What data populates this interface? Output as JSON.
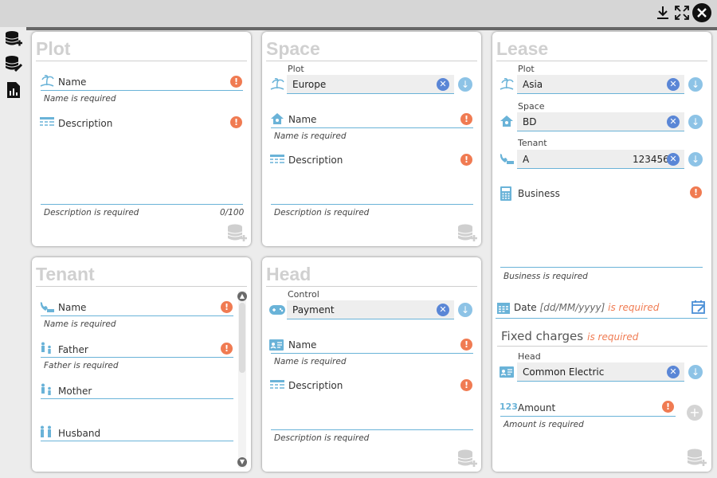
{
  "window": {
    "download_icon": "download-icon",
    "expand_icon": "expand-icon",
    "close_icon": "close-icon"
  },
  "sidebar": {
    "items": [
      {
        "icon": "database-add-icon"
      },
      {
        "icon": "database-edit-icon"
      },
      {
        "icon": "report-document-icon"
      }
    ]
  },
  "plot": {
    "title": "Plot",
    "name_label": "Name",
    "name_hint": "Name is required",
    "description_label": "Description",
    "description_hint": "Description is required",
    "description_counter": "0/100"
  },
  "space": {
    "title": "Space",
    "plot_label": "Plot",
    "plot_value": "Europe",
    "name_label": "Name",
    "name_hint": "Name is required",
    "description_label": "Description",
    "description_hint": "Description is required"
  },
  "lease": {
    "title": "Lease",
    "plot_label": "Plot",
    "plot_value": "Asia",
    "space_label": "Space",
    "space_value": "BD",
    "tenant_label": "Tenant",
    "tenant_value": "A",
    "tenant_phone": "123456",
    "business_label": "Business",
    "business_hint": "Business is required",
    "date_label": "Date",
    "date_placeholder": "[dd/MM/yyyy]",
    "date_required": "is required",
    "fixed_charges_label": "Fixed charges",
    "fixed_charges_required": "is required",
    "head_label": "Head",
    "head_value": "Common Electric",
    "amount_label": "Amount",
    "amount_icon_text": "123",
    "amount_hint": "Amount is required"
  },
  "tenant": {
    "title": "Tenant",
    "name_label": "Name",
    "name_hint": "Name is required",
    "father_label": "Father",
    "father_hint": "Father is required",
    "mother_label": "Mother",
    "husband_label": "Husband"
  },
  "head": {
    "title": "Head",
    "control_label": "Control",
    "control_value": "Payment",
    "name_label": "Name",
    "name_hint": "Name is required",
    "description_label": "Description",
    "description_hint": "Description is required"
  },
  "symbols": {
    "error": "!",
    "clear": "✕",
    "drop": "↓",
    "plus": "+",
    "scroll_up": "▲",
    "scroll_down": "▼"
  },
  "colors": {
    "accent_blue": "#6ab3d8",
    "error_orange": "#f07b52",
    "clear_blue": "#5a86d6",
    "title_grey": "#d0d0d0"
  }
}
